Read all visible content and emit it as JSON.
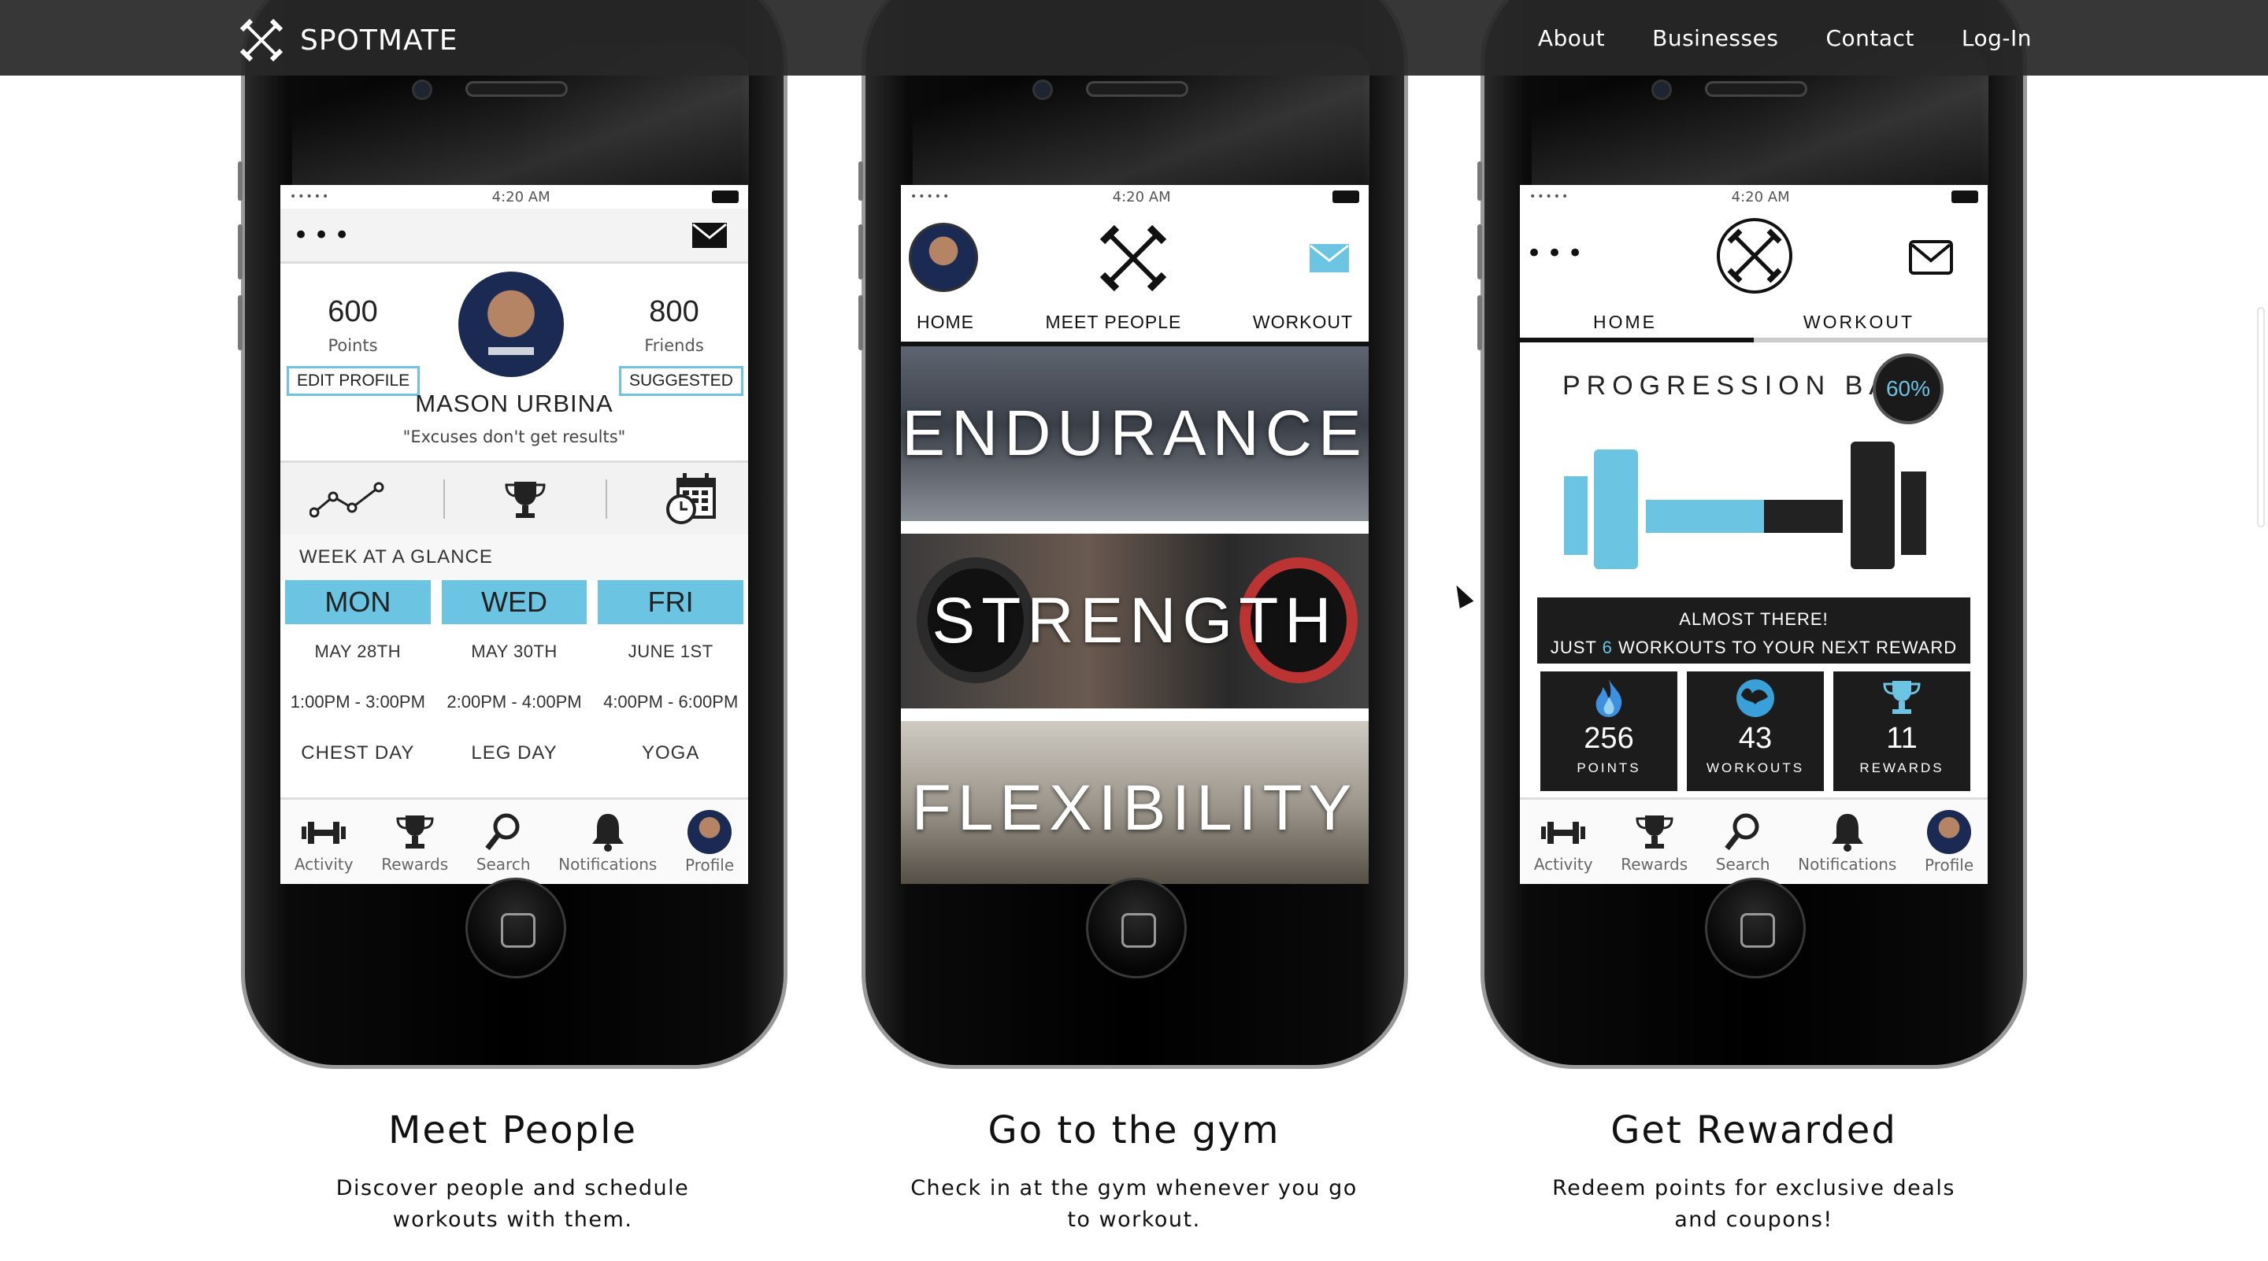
{
  "brand": {
    "name": "SPOTMATE"
  },
  "nav": [
    "About",
    "Businesses",
    "Contact",
    "Log-In"
  ],
  "colors": {
    "accent": "#6cc4e3",
    "topbar": "#282828",
    "dark_card": "#1c1c1c"
  },
  "phone_common": {
    "time": "4:20 AM",
    "signal": "•••••"
  },
  "phone1": {
    "points_value": "600",
    "points_label": "Points",
    "friends_value": "800",
    "friends_label": "Friends",
    "edit_profile": "EDIT PROFILE",
    "suggested": "SUGGESTED",
    "name": "MASON URBINA",
    "quote": "\"Excuses don't get results\"",
    "week_title": "WEEK AT A GLANCE",
    "days": [
      {
        "day": "MON",
        "date": "MAY 28TH",
        "time": "1:00PM - 3:00PM",
        "workout": "CHEST DAY"
      },
      {
        "day": "WED",
        "date": "MAY 30TH",
        "time": "2:00PM - 4:00PM",
        "workout": "LEG DAY"
      },
      {
        "day": "FRI",
        "date": "JUNE 1ST",
        "time": "4:00PM - 6:00PM",
        "workout": "YOGA"
      }
    ]
  },
  "tabbar": [
    "Activity",
    "Rewards",
    "Search",
    "Notifications",
    "Profile"
  ],
  "phone2": {
    "tabs": [
      "HOME",
      "MEET PEOPLE",
      "WORKOUT"
    ],
    "tiles": [
      "ENDURANCE",
      "STRENGTH",
      "FLEXIBILITY"
    ]
  },
  "phone3": {
    "tabs": [
      "HOME",
      "WORKOUT"
    ],
    "progress_title": "PROGRESSION BAR:",
    "progress_value": "60%",
    "progress_fraction": 0.6,
    "almost_line1": "ALMOST THERE!",
    "almost_pre": "JUST",
    "almost_num": "6",
    "almost_post": "WORKOUTS TO YOUR NEXT REWARD",
    "cards": [
      {
        "value": "256",
        "label": "POINTS"
      },
      {
        "value": "43",
        "label": "WORKOUTS"
      },
      {
        "value": "11",
        "label": "REWARDS"
      }
    ]
  },
  "features": [
    {
      "title": "Meet People",
      "desc_line1": "Discover people and schedule",
      "desc_line2": "workouts with them."
    },
    {
      "title": "Go to the gym",
      "desc_line1": "Check in at the gym whenever you go",
      "desc_line2": "to workout."
    },
    {
      "title": "Get Rewarded",
      "desc_line1": "Redeem points for exclusive deals",
      "desc_line2": "and coupons!"
    }
  ]
}
